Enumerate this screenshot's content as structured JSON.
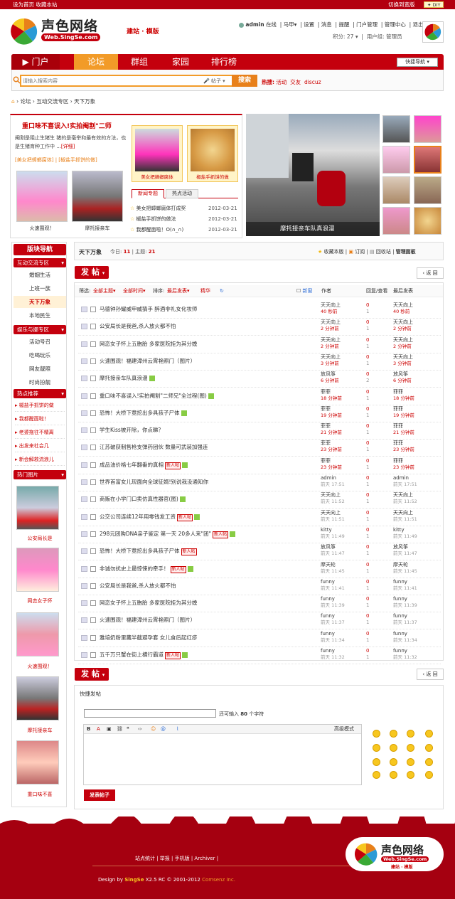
{
  "topbar": {
    "set_home": "设为首页",
    "bookmark": "收藏本站",
    "switch_width": "切换到宽版",
    "diy": "DIY"
  },
  "header": {
    "logo_text": "声色网络",
    "logo_url": "Web.SingSe.com",
    "subtitle": "建站 · 模版",
    "user": {
      "name": "admin",
      "status": "在线",
      "links": [
        "马甲",
        "设置",
        "消息",
        "提醒",
        "门户管理",
        "管理中心",
        "退出"
      ],
      "points_label": "积分: 27",
      "group_label": "用户组: 管理员"
    }
  },
  "nav": {
    "items": [
      "门户",
      "论坛",
      "群组",
      "家园",
      "排行榜"
    ],
    "quick_nav": "快捷导航"
  },
  "search": {
    "placeholder": "请输入搜索内容",
    "scope": "帖子",
    "button": "搜索",
    "hot_label": "热搜:",
    "hot_terms": [
      "活动",
      "交友",
      "discuz"
    ]
  },
  "breadcrumb": [
    "论坛",
    "互动交流专区",
    "天下万象"
  ],
  "featured": {
    "headline": "重口味不喜误入!实拍阉割\"二师",
    "summary": "阉割是阻止生猪生 猪的是毫举和最有效的方法，也是生猪育种工作中 ...",
    "detail_link": "[详细]",
    "tags": [
      "[美女把蟑螂腐体]",
      "[椒盐手抓饼的做]"
    ],
    "photos": [
      {
        "caption": "火速围观！"
      },
      {
        "caption": "摩托接亲车"
      }
    ],
    "mid_photos": [
      {
        "caption": "美女把蟑螂腐体"
      },
      {
        "caption": "椒盐手抓饼的做"
      }
    ],
    "tabs": [
      "新闻专题",
      "热点活动"
    ],
    "news": [
      {
        "title": "美女把蟑螂腐体打成奖",
        "date": "2012-03-21"
      },
      {
        "title": "椒盐手抓饼的做法",
        "date": "2012-03-21"
      },
      {
        "title": "我都醒面啦！O(∩_∩)",
        "date": "2012-03-21"
      }
    ],
    "slide_caption": "摩托接亲车队真浪漫"
  },
  "sidebar": {
    "title": "版块导航",
    "groups": [
      {
        "label": "互动交流专区",
        "items": [
          "婚姻生活",
          "上班一族",
          "天下万象",
          "本地民生"
        ]
      },
      {
        "label": "娱乐与挪专区",
        "items": [
          "活动号召",
          "吃喝玩乐",
          "网友靓照",
          "时尚扮靓"
        ]
      }
    ],
    "hot_label": "热点推荐",
    "hot_items": [
      "椒盐手抓饼的做",
      "我都醒面啦！",
      "老婆拖往不精离",
      "出发来社会几",
      "新会解救流浪儿"
    ],
    "pics_label": "热门图片",
    "pics": [
      "公安局长是",
      "网恋女子怀",
      "火速围观！",
      "摩托接亲车",
      "重口味不喜"
    ]
  },
  "forum": {
    "name": "天下万象",
    "today_label": "今日:",
    "today": "11",
    "threads_label": "主题:",
    "threads": "21",
    "actions": [
      "收藏本版",
      "订阅",
      "回收站",
      "管理面板"
    ],
    "post_button": "发 帖",
    "back_button": "返 回",
    "filter": {
      "label": "筛选:",
      "all_threads": "全部主题",
      "all_time": "全部时间",
      "sort": "排序:",
      "last_post": "最后发表",
      "digest": "精华",
      "new_window": "新窗",
      "author_col": "作者",
      "reply_col": "回复/查看",
      "last_col": "最后发表"
    }
  },
  "threads": [
    {
      "title": "马德钟孙耀威申威猜手 醉酒非礼女化妆师",
      "badge": "",
      "author": "天天向上",
      "atime": "40 秒前",
      "replies": "0",
      "views": "1",
      "last": "天天向上",
      "ltime": "40 秒前"
    },
    {
      "title": "公安局长是我爸,杀人放火都不怕",
      "badge": "",
      "author": "天天向上",
      "atime": "2 分钟前",
      "replies": "0",
      "views": "1",
      "last": "天天向上",
      "ltime": "2 分钟前"
    },
    {
      "title": "网恋女子怀上五胞胎 多家医院拒为其分娩",
      "badge": "",
      "author": "天天向上",
      "atime": "2 分钟前",
      "replies": "0",
      "views": "1",
      "last": "天天向上",
      "ltime": "2 分钟前"
    },
    {
      "title": "火速围观！福建漳州云霄艳照门（图片）",
      "badge": "",
      "author": "天天向上",
      "atime": "3 分钟前",
      "replies": "0",
      "views": "1",
      "last": "天天向上",
      "ltime": "3 分钟前"
    },
    {
      "title": "摩托接亲车队真浪漫",
      "badge": "",
      "author": "放风筝",
      "atime": "6 分钟前",
      "replies": "0",
      "views": "2",
      "last": "放风筝",
      "ltime": "6 分钟前"
    },
    {
      "title": "重口味不喜误入!实拍阉割\"二师兄\"全过程(图)",
      "badge": "",
      "author": "菲菲",
      "atime": "18 分钟前",
      "replies": "0",
      "views": "1",
      "last": "菲菲",
      "ltime": "18 分钟前"
    },
    {
      "title": "恐怖！大桥下竟挖出多具孩子尸体",
      "badge": "",
      "author": "菲菲",
      "atime": "19 分钟前",
      "replies": "0",
      "views": "1",
      "last": "菲菲",
      "ltime": "19 分钟前"
    },
    {
      "title": "学生Kiss被开除，你点睇？",
      "badge": "",
      "author": "菲菲",
      "atime": "21 分钟前",
      "replies": "0",
      "views": "1",
      "last": "菲菲",
      "ltime": "21 分钟前"
    },
    {
      "title": "江苏破获制售枪支弹药团伙 数量可武装加强连",
      "badge": "",
      "author": "菲菲",
      "atime": "23 分钟前",
      "replies": "0",
      "views": "1",
      "last": "菲菲",
      "ltime": "23 分钟前"
    },
    {
      "title": "成品油价格七年翻番的真相",
      "badge": "新人帖",
      "author": "菲菲",
      "atime": "23 分钟前",
      "replies": "0",
      "views": "1",
      "last": "菲菲",
      "ltime": "23 分钟前"
    },
    {
      "title": "世界首富女儿现面向全球征婿!别说我没通知你",
      "badge": "",
      "author": "admin",
      "atime": "前天 17:51",
      "replies": "0",
      "views": "1",
      "last": "admin",
      "ltime": "前天 17:51"
    },
    {
      "title": "商贩在小学门口卖仿真性器官(图)",
      "badge": "",
      "author": "天天向上",
      "atime": "前天 11:52",
      "replies": "0",
      "views": "1",
      "last": "天天向上",
      "ltime": "前天 11:52"
    },
    {
      "title": "公交公司连续12年用零钱发工资",
      "badge": "新人帖",
      "author": "天天向上",
      "atime": "前天 11:51",
      "replies": "0",
      "views": "1",
      "last": "天天向上",
      "ltime": "前天 11:51"
    },
    {
      "title": "298元团购DNA亲子鉴定 第一天 20多人来\"团\"",
      "badge": "新人帖",
      "author": "kitty",
      "atime": "前天 11:49",
      "replies": "0",
      "views": "1",
      "last": "kitty",
      "ltime": "前天 11:49"
    },
    {
      "title": "恐怖！大桥下竟挖出多具孩子尸体",
      "badge": "新人帖",
      "author": "放风筝",
      "atime": "前天 11:47",
      "replies": "0",
      "views": "1",
      "last": "放风筝",
      "ltime": "前天 11:47"
    },
    {
      "title": "非诚勿扰史上最惊悚的牵手！",
      "badge": "新人帖",
      "author": "摩天轮",
      "atime": "前天 11:45",
      "replies": "0",
      "views": "1",
      "last": "摩天轮",
      "ltime": "前天 11:45"
    },
    {
      "title": "公安局长是我爸,杀人放火都不怕",
      "badge": "",
      "author": "funny",
      "atime": "前天 11:41",
      "replies": "0",
      "views": "1",
      "last": "funny",
      "ltime": "前天 11:41"
    },
    {
      "title": "网恋女子怀上五胞胎 多家医院拒为其分娩",
      "badge": "",
      "author": "funny",
      "atime": "前天 11:39",
      "replies": "0",
      "views": "1",
      "last": "funny",
      "ltime": "前天 11:39"
    },
    {
      "title": "火速围观！福建漳州云霄艳照门（图片）",
      "badge": "",
      "author": "funny",
      "atime": "前天 11:37",
      "replies": "0",
      "views": "1",
      "last": "funny",
      "ltime": "前天 11:37"
    },
    {
      "title": "雅培奶粉里藏半截避孕套 女儿食后起红疹",
      "badge": "",
      "author": "funny",
      "atime": "前天 11:34",
      "replies": "0",
      "views": "1",
      "last": "funny",
      "ltime": "前天 11:34"
    },
    {
      "title": "五千万只蟹在街上横行霸道",
      "badge": "新人帖",
      "author": "funny",
      "atime": "前天 11:32",
      "replies": "0",
      "views": "1",
      "last": "funny",
      "ltime": "前天 11:32"
    }
  ],
  "quick_post": {
    "title": "快捷发帖",
    "limit_prefix": "还可输入",
    "limit_count": "80",
    "limit_suffix": "个字符",
    "advanced": "高级模式",
    "submit": "发表帖子"
  },
  "footer": {
    "links": "站点统计 | 举报 | 手机版 | Archiver |",
    "copy_prefix": "Design by",
    "brand": "SingSe",
    "copy_mid": "X2.5 RC © 2001-2012",
    "company": "Comsenz Inc."
  },
  "colors": {
    "brand_red": "#c4000d",
    "accent_orange": "#f29b28",
    "footer_red": "#a50010"
  }
}
